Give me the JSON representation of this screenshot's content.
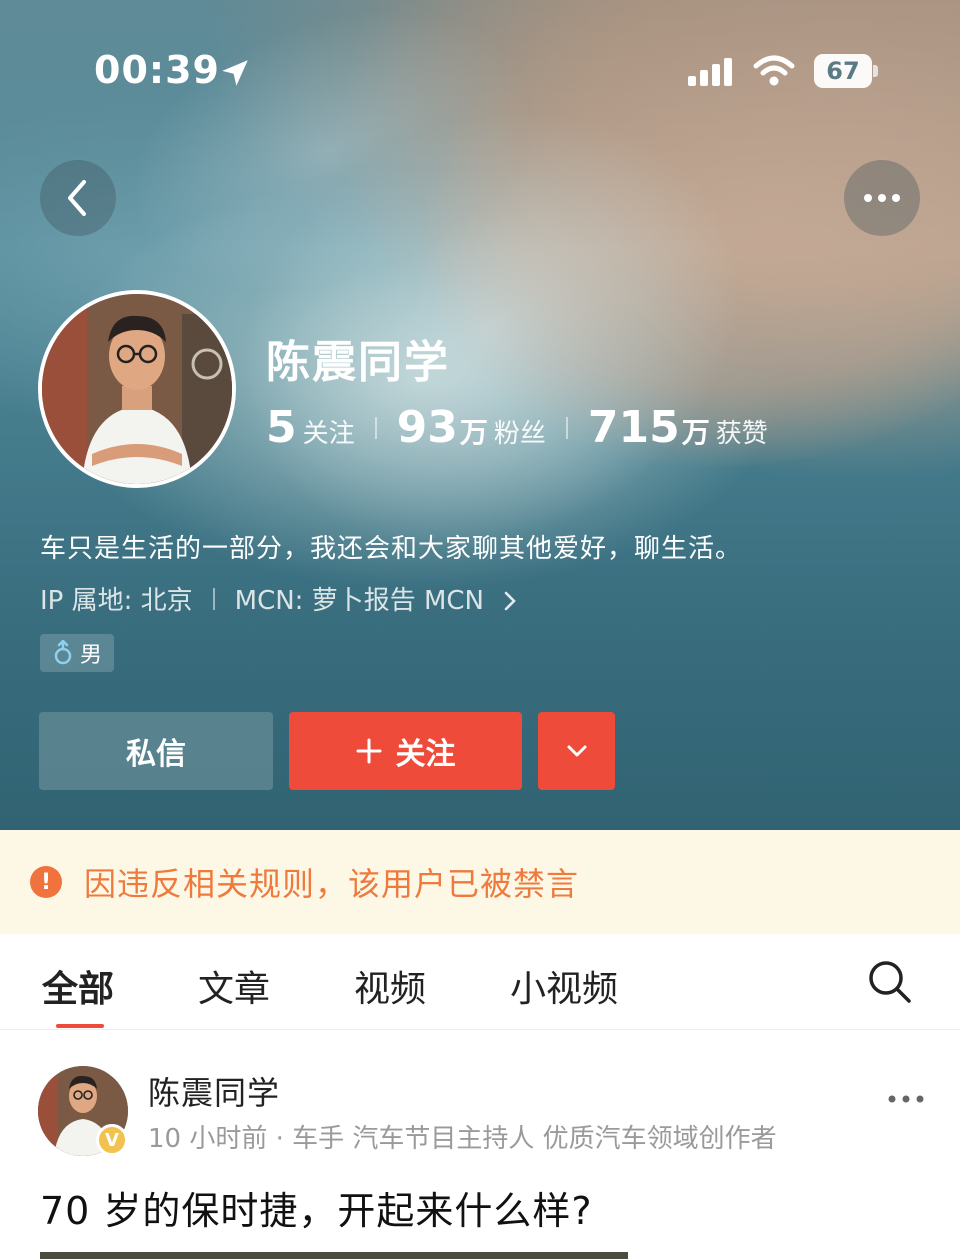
{
  "status_bar": {
    "time": "00:39",
    "battery": "67"
  },
  "nav": {
    "back_icon": "chevron-left-icon",
    "more_icon": "more-dots-icon"
  },
  "profile": {
    "name": "陈震同学",
    "stats": [
      {
        "num": "5",
        "unit": "",
        "label": "关注"
      },
      {
        "num": "93",
        "unit": "万",
        "label": "粉丝"
      },
      {
        "num": "715",
        "unit": "万",
        "label": "获赞"
      }
    ],
    "bio": "车只是生活的一部分，我还会和大家聊其他爱好，聊生活。",
    "ip_location": "IP 属地: 北京",
    "mcn": "MCN: 萝卜报告 MCN",
    "gender": "男"
  },
  "actions": {
    "message_label": "私信",
    "follow_label": "关注"
  },
  "notice": {
    "text": "因违反相关规则，该用户已被禁言",
    "color": "#ee7a3e"
  },
  "tabs": [
    {
      "label": "全部",
      "active": true
    },
    {
      "label": "文章",
      "active": false
    },
    {
      "label": "视频",
      "active": false
    },
    {
      "label": "小视频",
      "active": false
    }
  ],
  "post": {
    "author": "陈震同学",
    "badge": "V",
    "meta": "10 小时前 · 车手 汽车节目主持人 优质汽车领域创作者",
    "title": "70 岁的保时捷，开起来什么样?"
  },
  "colors": {
    "accent": "#ee4b3a",
    "notice_bg": "#fdf8e6"
  }
}
